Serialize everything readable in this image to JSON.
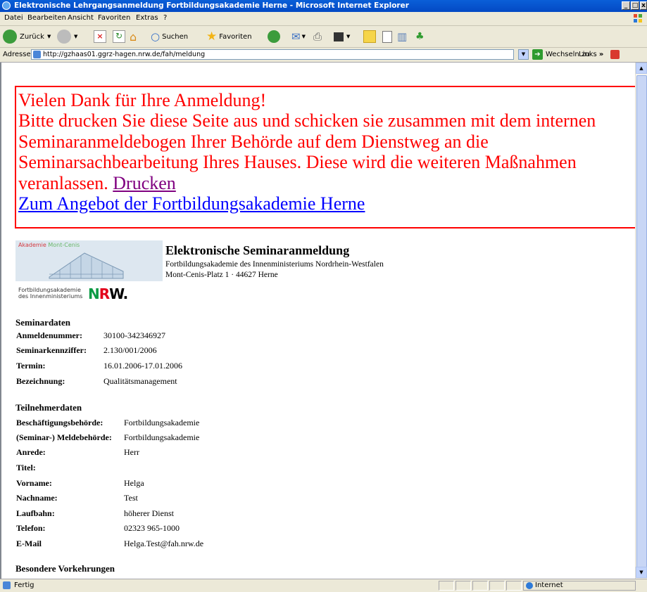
{
  "window": {
    "title": "Elektronische Lehrgangsanmeldung Fortbildungsakademie Herne - Microsoft Internet Explorer",
    "min": "_",
    "max": "□",
    "close": "x"
  },
  "menu": [
    "Datei",
    "Bearbeiten",
    "Ansicht",
    "Favoriten",
    "Extras",
    "?"
  ],
  "toolbar": {
    "back": "Zurück",
    "search": "Suchen",
    "favorites": "Favoriten"
  },
  "address": {
    "label": "Adresse",
    "url": "http://gzhaas01.ggrz-hagen.nrw.de/fah/meldung",
    "go": "Wechseln zu",
    "links": "Links"
  },
  "message": {
    "line1": "Vielen Dank für Ihre Anmeldung!",
    "line2": "Bitte drucken Sie diese Seite aus und schicken sie zusammen mit dem internen Seminaranmeldebogen Ihrer Behörde auf dem Dienstweg an die Seminarsachbearbeitung Ihres Hauses. Diese wird die weiteren Maßnahmen veranlassen.",
    "print_link": "Drucken",
    "home_link": "Zum Angebot der Fortbildungsakademie Herne"
  },
  "logo": {
    "akademie": "Akademie",
    "montcenis": "Mont-Cenis",
    "fb_line1": "Fortbildungsakademie",
    "fb_line2": "des Innenministeriums",
    "nrw_n": "N",
    "nrw_r": "R",
    "nrw_w": "W."
  },
  "header": {
    "title": "Elektronische Seminaranmeldung",
    "line1": "Fortbildungsakademie des Innenministeriums Nordrhein-Westfalen",
    "line2": "Mont-Cenis-Platz 1 · 44627 Herne"
  },
  "seminar": {
    "heading": "Seminardaten",
    "rows": [
      {
        "label": "Anmeldenummer:",
        "value": "30100-342346927"
      },
      {
        "label": "Seminarkennziffer:",
        "value": "2.130/001/2006"
      },
      {
        "label": "Termin:",
        "value": "16.01.2006-17.01.2006"
      },
      {
        "label": "Bezeichnung:",
        "value": "Qualitätsmanagement"
      }
    ]
  },
  "participant": {
    "heading": "Teilnehmerdaten",
    "rows": [
      {
        "label": "Beschäftigungsbehörde:",
        "value": "Fortbildungsakademie"
      },
      {
        "label": "(Seminar-) Meldebehörde:",
        "value": "Fortbildungsakademie"
      },
      {
        "label": "Anrede:",
        "value": "Herr"
      },
      {
        "label": "Titel:",
        "value": ""
      },
      {
        "label": "Vorname:",
        "value": "Helga"
      },
      {
        "label": "Nachname:",
        "value": "Test"
      },
      {
        "label": "Laufbahn:",
        "value": "höherer Dienst"
      },
      {
        "label": "Telefon:",
        "value": "02323 965-1000"
      },
      {
        "label": "E-Mail",
        "value": "Helga.Test@fah.nrw.de"
      }
    ]
  },
  "special": {
    "heading": "Besondere Vorkehrungen"
  },
  "status": {
    "text": "Fertig",
    "zone": "Internet"
  }
}
